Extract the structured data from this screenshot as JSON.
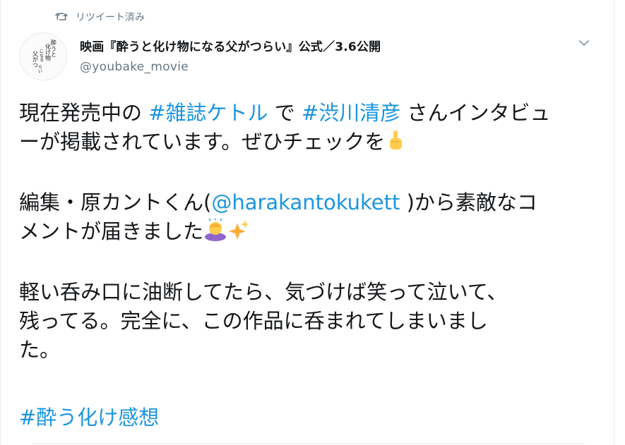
{
  "retweet": {
    "label": "リツイート済み",
    "icon": "retweet-icon"
  },
  "author": {
    "display_name": "映画『酔うと化け物になる父がつらい』公式／3.6公開",
    "handle": "@youbake_movie",
    "avatar_text": "酔うと化け物になる父がつらい"
  },
  "tweet": {
    "line1_a": "現在発売中の ",
    "hashtag1": "#雑誌ケトル",
    "line1_b": " で ",
    "hashtag2": "#渋川清彦",
    "line1_c": " さんインタビュ",
    "line2": "ーが掲載されています。ぜひチェックを",
    "emoji_pointing_up": "point-up-icon",
    "line3_a": "編集・原カントくん(",
    "mention": "@harakantokukett",
    "line3_b": " )から素敵なコ",
    "line4": "メントが届きました",
    "emoji_bowing": "bowing-person-icon",
    "emoji_sparkles": "sparkles-icon",
    "line5": "軽い呑み口に油断してたら、気づけば笑って泣いて、",
    "line6": "残ってる。完全に、この作品に呑まれてしまいまし",
    "line7": "た。",
    "hashtag3": "#酔う化け感想"
  },
  "colors": {
    "link": "#1b95e0",
    "muted": "#657786",
    "text": "#14171a"
  }
}
